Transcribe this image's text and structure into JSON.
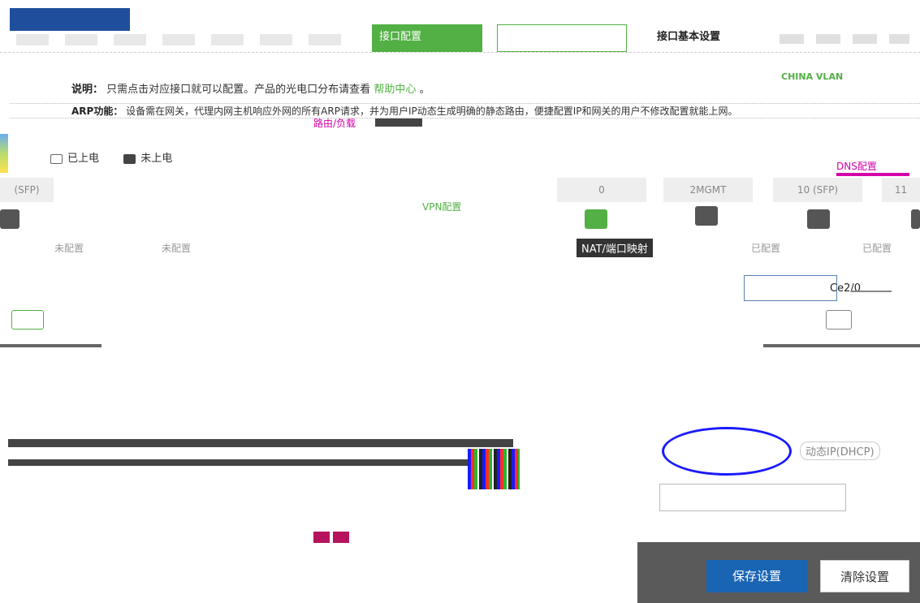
{
  "header": {
    "tabs": [
      {
        "label": "接口配置"
      },
      {
        "label": "接口基本设置"
      }
    ]
  },
  "notice": {
    "prefix": "说明：",
    "text": "只需点击对应接口就可以配置。产品的光电口分布请查看",
    "help_link": "帮助中心",
    "suffix": "。",
    "arp_label": "ARP功能：",
    "arp_text": "设备需在网关，代理内网主机响应外网的所有ARP请求，并为用户IP动态生成明确的静态路由，便捷配置IP和网关的用户不修改配置就能上网。"
  },
  "floating_labels": {
    "route": "路由/负载",
    "vlan": "CHINA VLAN",
    "dns": "DNS配置",
    "vpn": "VPN配置",
    "nat": "NAT/端口映射",
    "port_name": "Ce2/0",
    "dhcp": "动态IP(DHCP)"
  },
  "legend": {
    "powered": "已上电",
    "unpowered": "未上电"
  },
  "port_tabs": [
    {
      "label": "(SFP)"
    },
    {
      "label": "0"
    },
    {
      "label": "2MGMT"
    },
    {
      "label": "10 (SFP)"
    },
    {
      "label": "11"
    }
  ],
  "ports": [
    {
      "status": "未配置"
    },
    {
      "status": "未配置"
    },
    {
      "status": "已配置"
    },
    {
      "status": "已配置"
    }
  ],
  "footer": {
    "save_label": "保存设置",
    "clear_label": "清除设置"
  },
  "colors": {
    "accent_green": "#52b044",
    "primary_blue": "#1a64b4",
    "magenta": "#d400a8"
  }
}
